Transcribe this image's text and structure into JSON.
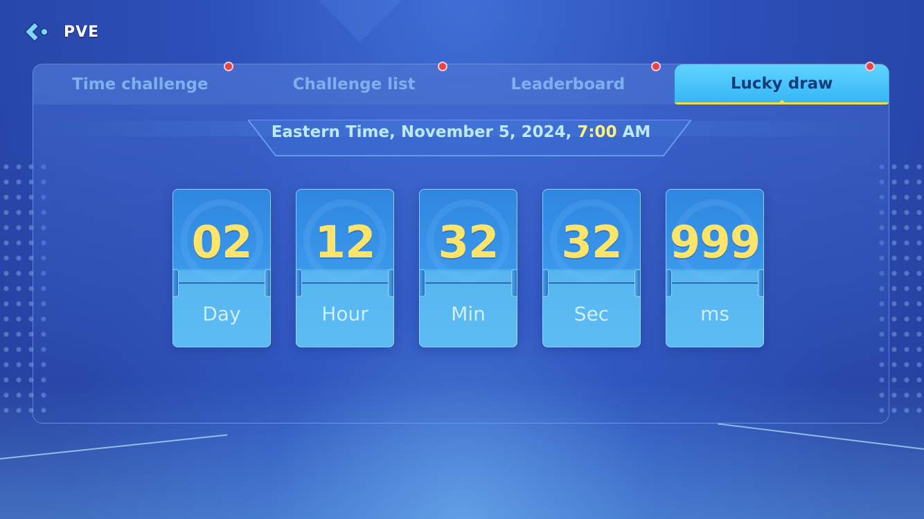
{
  "header": {
    "back_icon": "back-arrow-icon",
    "title": "PVE"
  },
  "tabs": [
    {
      "label": "Time challenge",
      "active": false,
      "badge": true
    },
    {
      "label": "Challenge list",
      "active": false,
      "badge": true
    },
    {
      "label": "Leaderboard",
      "active": false,
      "badge": true
    },
    {
      "label": "Lucky draw",
      "active": true,
      "badge": true
    }
  ],
  "schedule": {
    "prefix": "Eastern Time, November 5, 2024, ",
    "time": "7:00",
    "suffix": " AM"
  },
  "countdown": [
    {
      "value": "02",
      "unit": "Day"
    },
    {
      "value": "12",
      "unit": "Hour"
    },
    {
      "value": "32",
      "unit": "Min"
    },
    {
      "value": "32",
      "unit": "Sec"
    },
    {
      "value": "999",
      "unit": "ms"
    }
  ],
  "colors": {
    "accent_yellow": "#ffe46a",
    "active_tab": "#37b6f5",
    "badge_red": "#e2454d"
  }
}
